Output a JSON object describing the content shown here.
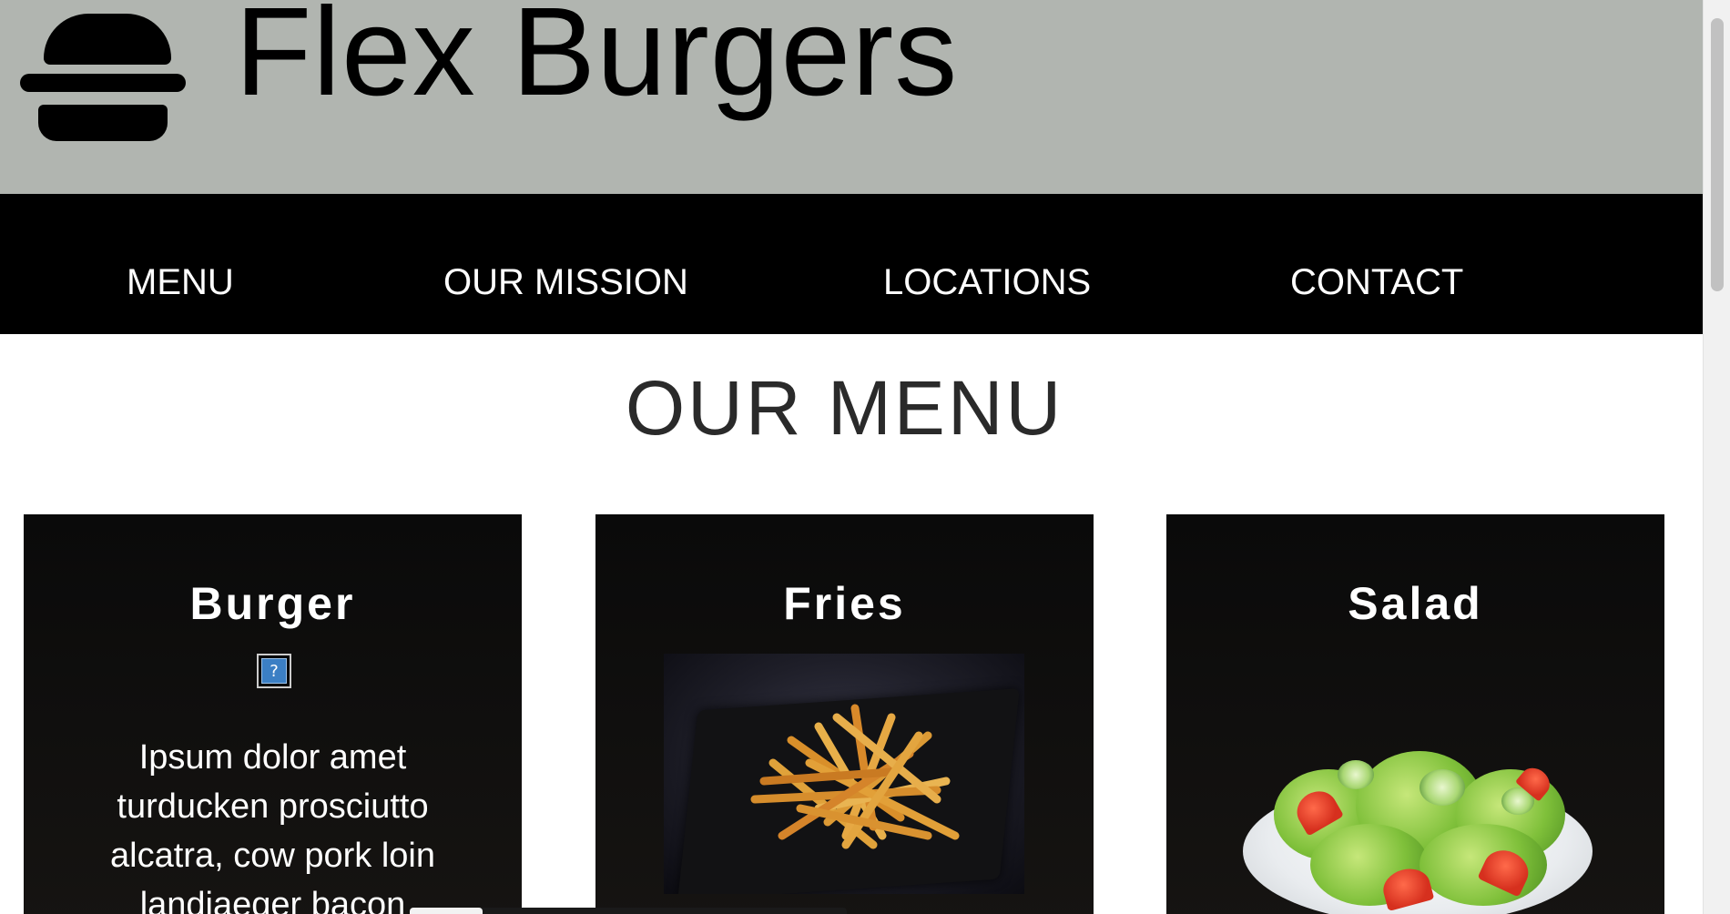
{
  "header": {
    "logo_icon": "burger-icon",
    "title": "Flex Burgers",
    "background": "#b1b5b0"
  },
  "nav": {
    "background": "#000000",
    "items": [
      {
        "label": "MENU"
      },
      {
        "label": "OUR MISSION"
      },
      {
        "label": "LOCATIONS"
      },
      {
        "label": "CONTACT"
      }
    ]
  },
  "main": {
    "heading": "OUR MENU",
    "cards": [
      {
        "title": "Burger",
        "image": "broken-image-icon",
        "description": "Ipsum dolor amet turducken prosciutto alcatra, cow pork loin landjaeger bacon"
      },
      {
        "title": "Fries",
        "image": "fries-photo"
      },
      {
        "title": "Salad",
        "image": "salad-photo"
      }
    ]
  },
  "colors": {
    "card_background": "#0e0d0c",
    "text_light": "#ffffff",
    "heading_text": "#2a2a2a"
  }
}
